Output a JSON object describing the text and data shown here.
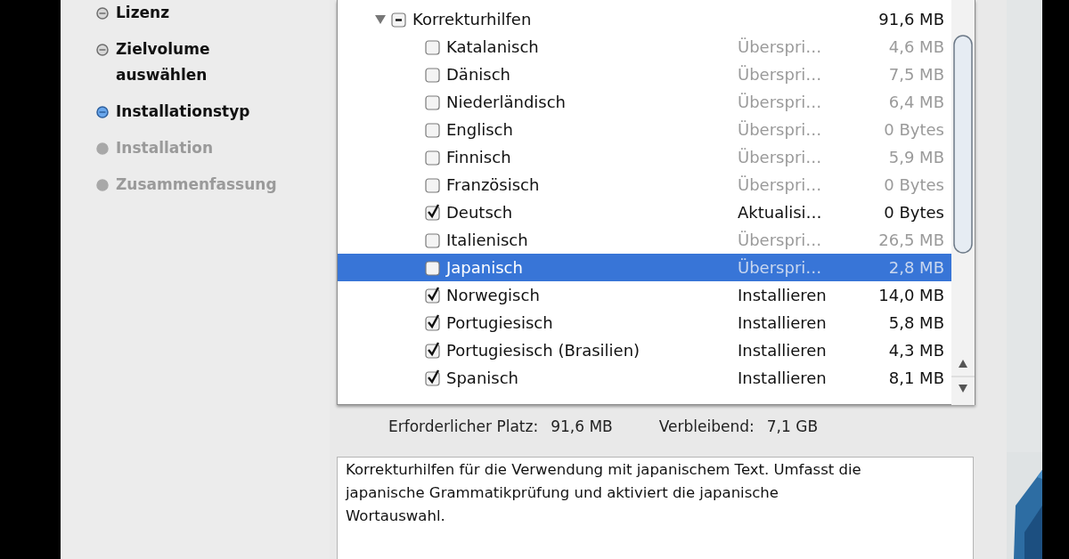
{
  "sidebar": {
    "steps": [
      {
        "label": "Lizenz",
        "completed": true,
        "current": false
      },
      {
        "label": "Zielvolume auswählen",
        "completed": true,
        "current": false
      },
      {
        "label": "Installationstyp",
        "completed": false,
        "current": true
      },
      {
        "label": "Installation",
        "completed": false,
        "current": false
      },
      {
        "label": "Zusammenfassung",
        "completed": false,
        "current": false
      }
    ]
  },
  "package_list": {
    "items": [
      {
        "name": "Korrekturhilfen",
        "expanded": true,
        "checked": true,
        "partial": true,
        "selected": false,
        "size": "91,6 MB",
        "children": [
          {
            "name": "Katalanisch",
            "checked": false,
            "skipped": true,
            "selected": false,
            "action": "Überspri…",
            "size": "4,6 MB"
          },
          {
            "name": "Dänisch",
            "checked": false,
            "skipped": true,
            "selected": false,
            "action": "Überspri…",
            "size": "7,5 MB"
          },
          {
            "name": "Niederländisch",
            "checked": false,
            "skipped": true,
            "selected": false,
            "action": "Überspri…",
            "size": "6,4 MB"
          },
          {
            "name": "Englisch",
            "checked": false,
            "skipped": true,
            "selected": false,
            "action": "Überspri…",
            "size": "0 Bytes"
          },
          {
            "name": "Finnisch",
            "checked": false,
            "skipped": true,
            "selected": false,
            "action": "Überspri…",
            "size": "5,9 MB"
          },
          {
            "name": "Französisch",
            "checked": false,
            "skipped": true,
            "selected": false,
            "action": "Überspri…",
            "size": "0 Bytes"
          },
          {
            "name": "Deutsch",
            "checked": true,
            "skipped": false,
            "selected": false,
            "action": "Aktualisi…",
            "size": "0 Bytes"
          },
          {
            "name": "Italienisch",
            "checked": false,
            "skipped": true,
            "selected": false,
            "action": "Überspri…",
            "size": "26,5 MB"
          },
          {
            "name": "Japanisch",
            "checked": false,
            "skipped": true,
            "selected": true,
            "action": "Überspri…",
            "size": "2,8 MB"
          },
          {
            "name": "Norwegisch",
            "checked": true,
            "skipped": false,
            "selected": false,
            "action": "Installieren",
            "size": "14,0 MB"
          },
          {
            "name": "Portugiesisch",
            "checked": true,
            "skipped": false,
            "selected": false,
            "action": "Installieren",
            "size": "5,8 MB"
          },
          {
            "name": "Portugiesisch (Brasilien)",
            "checked": true,
            "skipped": false,
            "selected": false,
            "action": "Installieren",
            "size": "4,3 MB"
          },
          {
            "name": "Spanisch",
            "checked": true,
            "skipped": false,
            "selected": false,
            "action": "Installieren",
            "size": "8,1 MB"
          }
        ]
      }
    ]
  },
  "space": {
    "required_label": "Erforderlicher Platz:",
    "required_value": "91,6 MB",
    "remaining_label": "Verbleibend:",
    "remaining_value": "7,1 GB"
  },
  "description": "Korrekturhilfen für die Verwendung mit japanischem Text. Umfasst die japanische Grammatikprüfung und aktiviert die japanische Wortauswahl."
}
